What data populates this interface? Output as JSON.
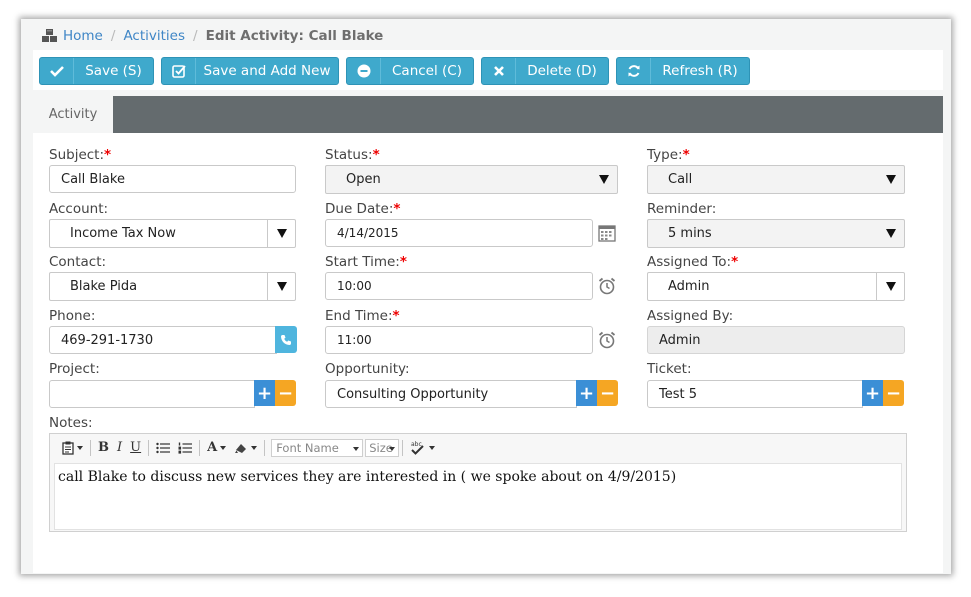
{
  "breadcrumb": {
    "home": "Home",
    "activities": "Activities",
    "current": "Edit Activity: Call Blake"
  },
  "toolbar": {
    "save": "Save (S)",
    "save_add": "Save and Add New",
    "cancel": "Cancel (C)",
    "delete": "Delete (D)",
    "refresh": "Refresh (R)"
  },
  "tabs": {
    "activity": "Activity"
  },
  "form": {
    "subject": {
      "label": "Subject:",
      "value": "Call Blake"
    },
    "status": {
      "label": "Status:",
      "value": "Open"
    },
    "type": {
      "label": "Type:",
      "value": "Call"
    },
    "account": {
      "label": "Account:",
      "value": "Income Tax Now"
    },
    "due_date": {
      "label": "Due Date:",
      "value": "4/14/2015"
    },
    "reminder": {
      "label": "Reminder:",
      "value": "5 mins"
    },
    "contact": {
      "label": "Contact:",
      "value": "Blake Pida"
    },
    "start_time": {
      "label": "Start Time:",
      "value": "10:00"
    },
    "assigned_to": {
      "label": "Assigned To:",
      "value": "Admin"
    },
    "phone": {
      "label": "Phone:",
      "value": "469-291-1730"
    },
    "end_time": {
      "label": "End Time:",
      "value": "11:00"
    },
    "assigned_by": {
      "label": "Assigned By:",
      "value": "Admin"
    },
    "project": {
      "label": "Project:",
      "value": ""
    },
    "opportunity": {
      "label": "Opportunity:",
      "value": "Consulting Opportunity"
    },
    "ticket": {
      "label": "Ticket:",
      "value": "Test 5"
    },
    "notes": {
      "label": "Notes:",
      "value": "call Blake to discuss new services they are interested in  ( we spoke about on 4/9/2015)"
    },
    "required_mark": "*",
    "plus": "+",
    "minus": "−"
  },
  "editor": {
    "bold": "B",
    "italic": "I",
    "underline": "U",
    "font_color": "A",
    "font_name": "Font Name",
    "size": "Size"
  },
  "colors": {
    "button": "#3fa9cc",
    "tabbar": "#646b6e",
    "required": "#e00000",
    "plus": "#3b8fd6",
    "minus": "#f5a623"
  }
}
